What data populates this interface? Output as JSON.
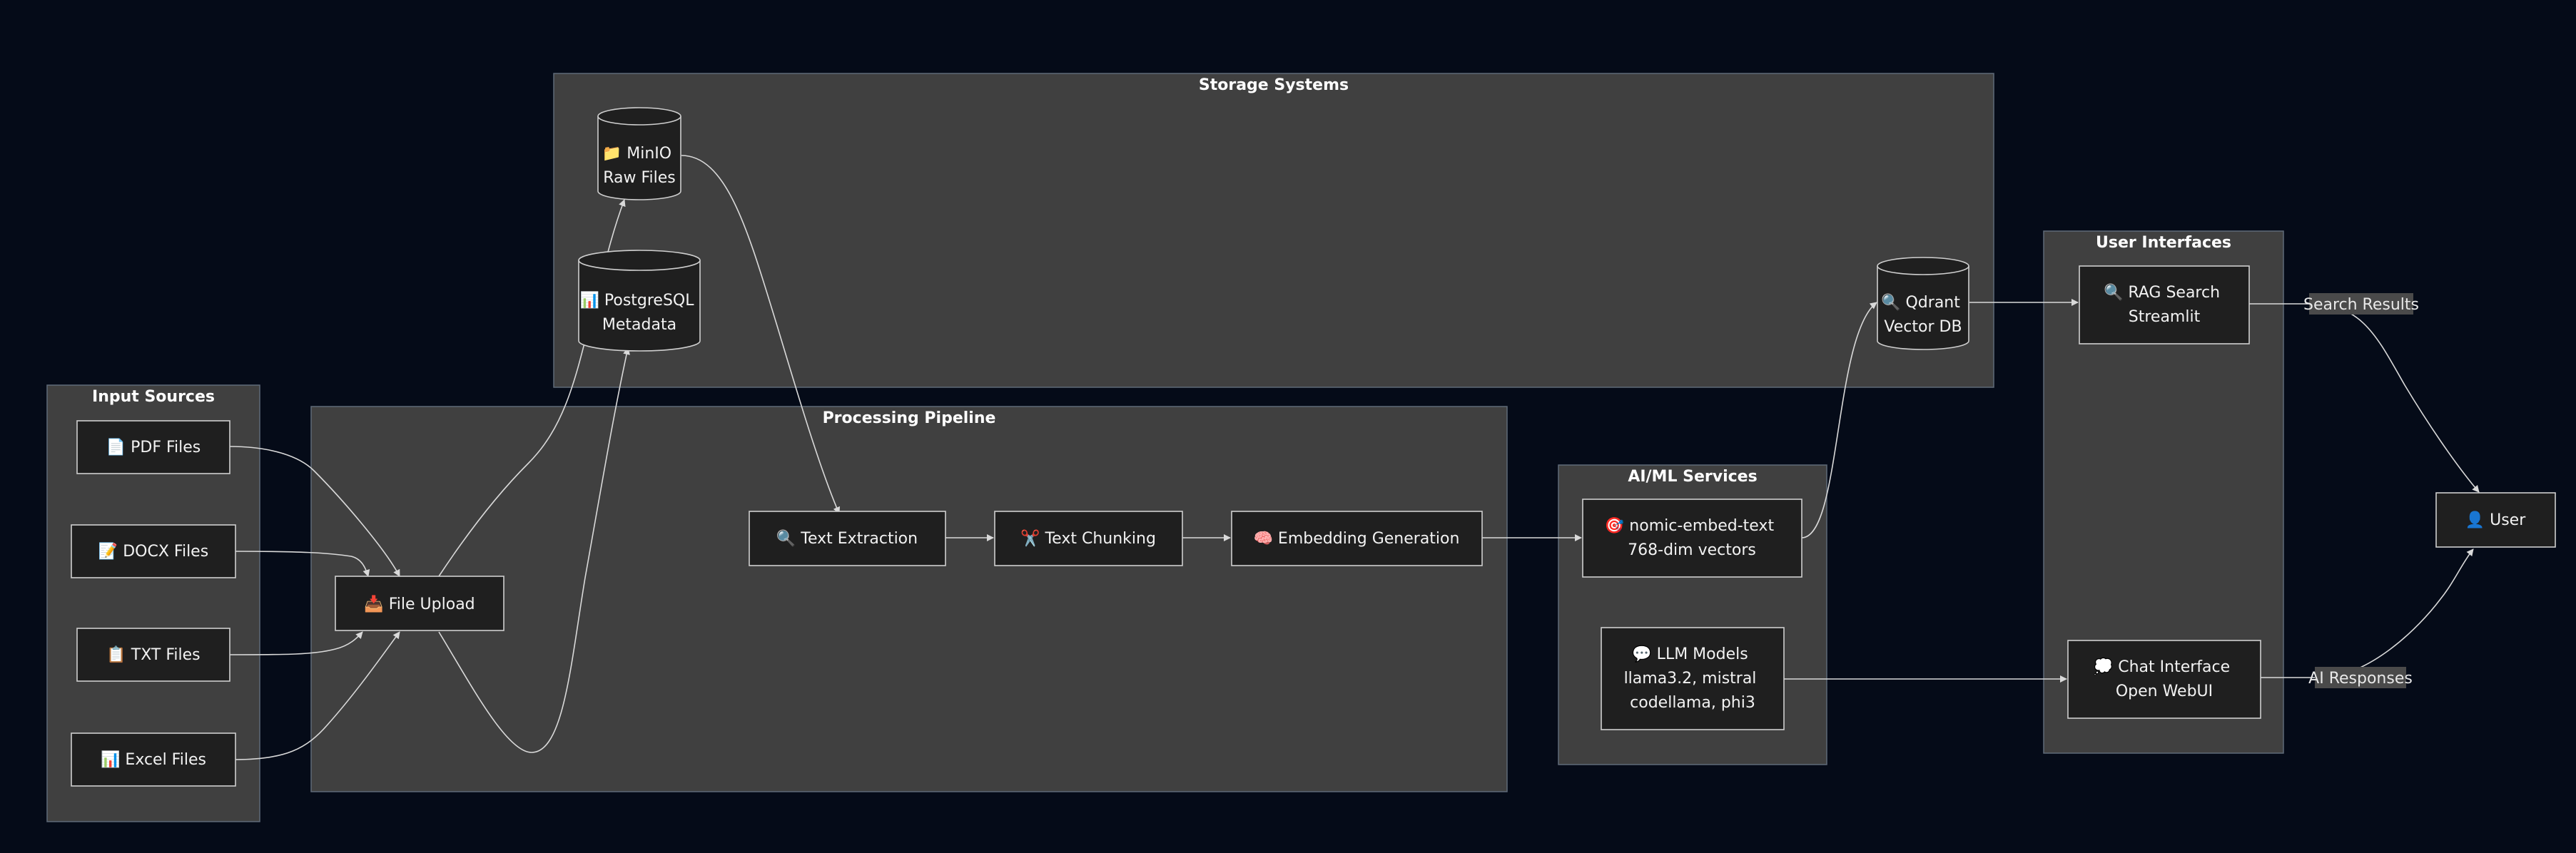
{
  "clusters": {
    "input": "Input Sources",
    "processing": "Processing Pipeline",
    "storage": "Storage Systems",
    "aiml": "AI/ML Services",
    "ui": "User Interfaces"
  },
  "nodes": {
    "pdf": [
      "📄 PDF Files"
    ],
    "docx": [
      "📝 DOCX Files"
    ],
    "txt": [
      "📋 TXT Files"
    ],
    "excel": [
      "📊 Excel Files"
    ],
    "upload": [
      "📥 File Upload"
    ],
    "extract": [
      "🔍 Text Extraction"
    ],
    "chunk": [
      "✂️ Text Chunking"
    ],
    "embed": [
      "🧠 Embedding Generation"
    ],
    "minio": [
      "📁 MinIO",
      "Raw Files"
    ],
    "postgres": [
      "📊 PostgreSQL",
      "Metadata"
    ],
    "qdrant": [
      "🔍 Qdrant",
      "Vector DB"
    ],
    "nomic": [
      "🎯 nomic-embed-text",
      "768-dim vectors"
    ],
    "llm": [
      "💬 LLM Models",
      "llama3.2, mistral",
      "codellama, phi3"
    ],
    "rag": [
      "🔍 RAG Search",
      "Streamlit"
    ],
    "chat": [
      "💭 Chat Interface",
      "Open WebUI"
    ],
    "user": [
      "👤 User"
    ]
  },
  "edge_labels": {
    "search_results": "Search Results",
    "ai_responses": "AI Responses"
  },
  "colors": {
    "background": "#050b18",
    "cluster_fill": "#404040",
    "node_fill": "#1f1f1f",
    "node_stroke": "#cfcfcf",
    "edge": "#d9d9d9"
  }
}
